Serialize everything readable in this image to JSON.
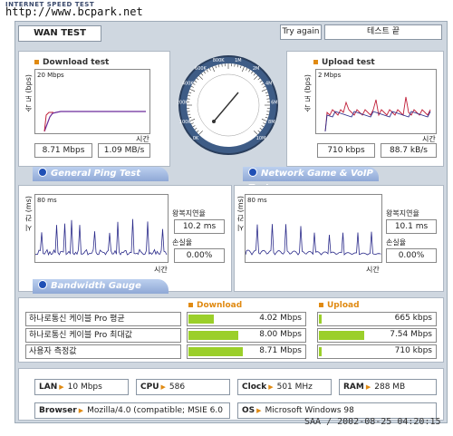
{
  "brand": "INTERNET SPEED TEST",
  "url": "http://www.bcpark.net",
  "header": {
    "tab": "WAN TEST",
    "try_again": "Try again",
    "test_button": "테스트 끝"
  },
  "download_test": {
    "title": "Download test",
    "ylabel": "속 도 (bps)",
    "scale": "20 Mbps",
    "xlabel": "시간",
    "value_bps": "8.71 Mbps",
    "value_bytes": "1.09 MB/s",
    "line_color": "#6a2a9a"
  },
  "upload_test": {
    "title": "Upload test",
    "ylabel": "속 도 (bps)",
    "scale": "2 Mbps",
    "xlabel": "시간",
    "value_bps": "710 kbps",
    "value_bytes": "88.7 kB/s",
    "line_color": "#c0203a"
  },
  "gauge": {
    "ticks": [
      "0K",
      "100K",
      "200K",
      "400K",
      "600K",
      "800K",
      "1M",
      "2M",
      "4M",
      "6M",
      "8M",
      "10M"
    ],
    "needle_value": "8M"
  },
  "general_ping": {
    "title": "General Ping Test",
    "ylabel": "시 간 (ms)",
    "scale": "80 ms",
    "xlabel": "시간",
    "rtt_label": "왕복지연율",
    "rtt_value": "10.2 ms",
    "loss_label": "손실율",
    "loss_value": "0.00%"
  },
  "game_ping": {
    "title": "Network Game & VoIP Test",
    "ylabel": "시 간 (ms)",
    "scale": "80 ms",
    "xlabel": "시간",
    "rtt_label": "왕복지연율",
    "rtt_value": "10.1 ms",
    "loss_label": "손실율",
    "loss_value": "0.00%"
  },
  "bandwidth": {
    "title": "Bandwidth Gauge",
    "download_header": "Download",
    "upload_header": "Upload",
    "rows": [
      {
        "label": "하나로통신 케이블 Pro 평균",
        "down": "4.02 Mbps",
        "down_frac": 0.46,
        "up": "665 kbps",
        "up_frac": 0.05
      },
      {
        "label": "하나로통신 케이블 Pro 최대값",
        "down": "8.00 Mbps",
        "down_frac": 0.92,
        "up": "7.54 Mbps",
        "up_frac": 0.92
      },
      {
        "label": "사용자 측정값",
        "down": "8.71 Mbps",
        "down_frac": 1.0,
        "up": "710 kbps",
        "up_frac": 0.05
      }
    ]
  },
  "system": {
    "lan_label": "LAN",
    "lan": "10 Mbps",
    "cpu_label": "CPU",
    "cpu": "586",
    "clock_label": "Clock",
    "clock": "501 MHz",
    "ram_label": "RAM",
    "ram": "288 MB",
    "browser_label": "Browser",
    "browser": "Mozilla/4.0 (compatible; MSIE 6.0",
    "os_label": "OS",
    "os": "Microsoft Windows 98"
  },
  "timestamp": "SAA / 2002-08-25 04:20:15",
  "colors": {
    "accent": "#e08a12",
    "bar": "#9bcf2a",
    "pill": "#8fa8d6",
    "ping_line": "#2b2b8a"
  }
}
